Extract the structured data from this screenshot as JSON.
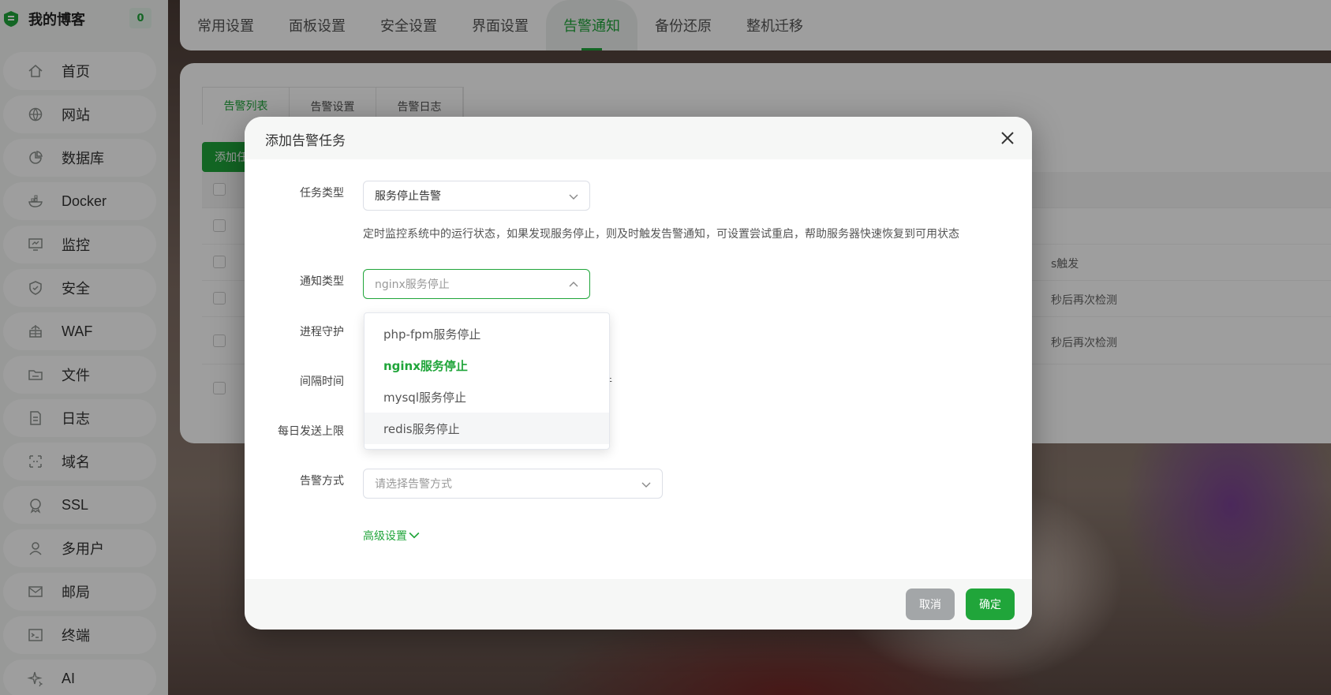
{
  "brand": {
    "name": "我的博客",
    "badge": "0"
  },
  "sidebar": {
    "items": [
      {
        "label": "首页",
        "icon": "home-icon"
      },
      {
        "label": "网站",
        "icon": "globe-icon"
      },
      {
        "label": "数据库",
        "icon": "database-icon"
      },
      {
        "label": "Docker",
        "icon": "docker-icon"
      },
      {
        "label": "监控",
        "icon": "monitor-icon"
      },
      {
        "label": "安全",
        "icon": "shield-icon"
      },
      {
        "label": "WAF",
        "icon": "firewall-icon"
      },
      {
        "label": "文件",
        "icon": "folder-icon"
      },
      {
        "label": "日志",
        "icon": "log-icon"
      },
      {
        "label": "域名",
        "icon": "domain-icon"
      },
      {
        "label": "SSL",
        "icon": "ssl-icon"
      },
      {
        "label": "多用户",
        "icon": "user-icon"
      },
      {
        "label": "邮局",
        "icon": "mail-icon"
      },
      {
        "label": "终端",
        "icon": "terminal-icon"
      },
      {
        "label": "AI",
        "icon": "sparkle-icon"
      }
    ]
  },
  "tabs": [
    "常用设置",
    "面板设置",
    "安全设置",
    "界面设置",
    "告警通知",
    "备份还原",
    "整机迁移"
  ],
  "active_tab": "告警通知",
  "panel": {
    "subtabs": [
      "告警列表",
      "告警设置",
      "告警日志"
    ],
    "add_button": "添加任",
    "rows_tail": [
      "s触发",
      "秒后再次检测",
      "秒后再次检测"
    ]
  },
  "modal": {
    "title": "添加告警任务",
    "fields": {
      "task_type": {
        "label": "任务类型",
        "value": "服务停止告警"
      },
      "hint": "定时监控系统中的运行状态，如果发现服务停止，则及时触发告警通知，可设置尝试重启，帮助服务器快速恢复到可用状态",
      "notify_type": {
        "label": "通知类型",
        "placeholder": "nginx服务停止"
      },
      "process_guard": {
        "label": "进程守护"
      },
      "interval": {
        "label": "间隔时间",
        "partial_text": "条件"
      },
      "daily_limit": {
        "label": "每日发送上限"
      },
      "alert_method": {
        "label": "告警方式",
        "placeholder": "请选择告警方式"
      }
    },
    "advanced": "高级设置",
    "cancel": "取消",
    "confirm": "确定"
  },
  "dropdown": {
    "options": [
      "php-fpm服务停止",
      "nginx服务停止",
      "mysql服务停止",
      "redis服务停止"
    ],
    "selected": "nginx服务停止",
    "hovered": "redis服务停止"
  },
  "colors": {
    "accent": "#20a53a",
    "cancel": "#a3a6a8"
  }
}
